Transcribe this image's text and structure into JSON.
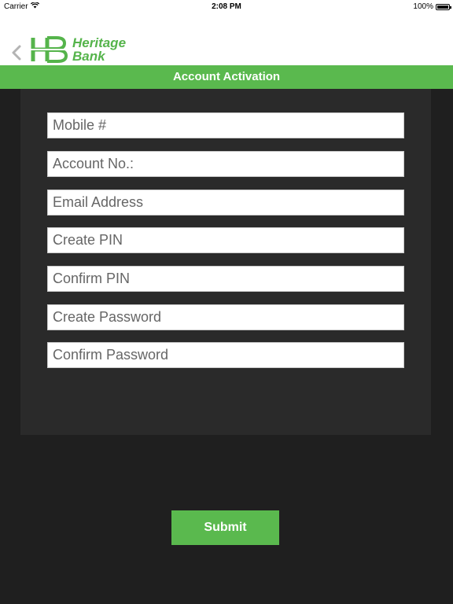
{
  "status_bar": {
    "carrier": "Carrier",
    "time": "2:08 PM",
    "battery": "100%"
  },
  "header": {
    "logo_line1": "Heritage",
    "logo_line2": "Bank",
    "title": "Account Activation"
  },
  "form": {
    "fields": [
      {
        "placeholder": "Mobile #",
        "value": ""
      },
      {
        "placeholder": "Account No.:",
        "value": ""
      },
      {
        "placeholder": "Email Address",
        "value": ""
      },
      {
        "placeholder": "Create PIN",
        "value": ""
      },
      {
        "placeholder": "Confirm PIN",
        "value": ""
      },
      {
        "placeholder": "Create Password",
        "value": ""
      },
      {
        "placeholder": "Confirm Password",
        "value": ""
      }
    ],
    "submit_label": "Submit"
  },
  "colors": {
    "brand_green": "#5ab94e",
    "background": "#1f1f1f",
    "panel": "#2a2a2a"
  },
  "icons": {
    "wifi": "wifi-icon",
    "battery": "battery-icon",
    "back": "chevron-left-icon",
    "logo": "heritage-bank-logo"
  }
}
